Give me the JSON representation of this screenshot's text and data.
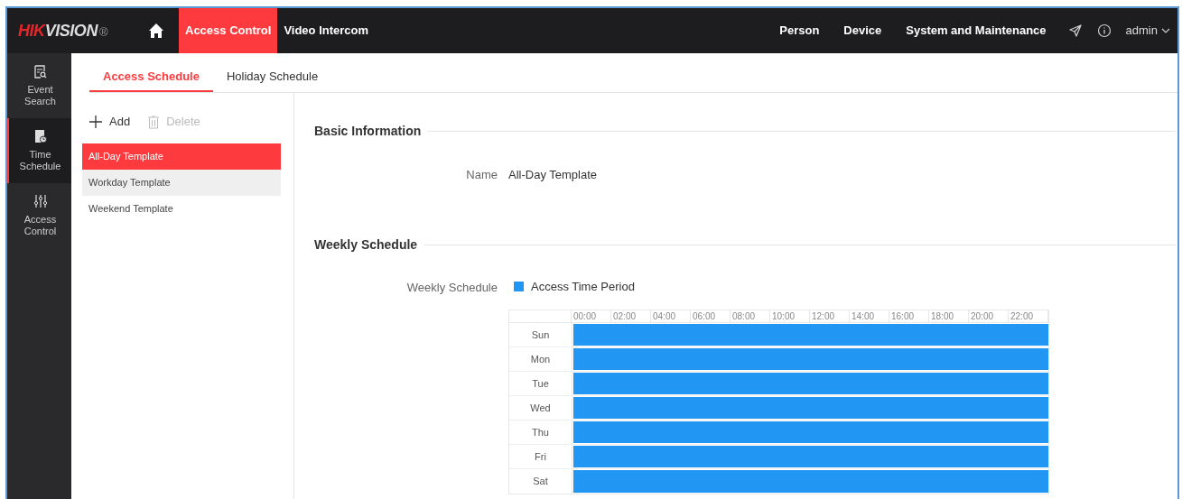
{
  "header": {
    "logo": "HIKVISION",
    "logo_mark": "®",
    "nav": [
      {
        "label": "Access Control",
        "selected": true
      },
      {
        "label": "Video Intercom",
        "selected": false
      }
    ],
    "right_nav": [
      "Person",
      "Device",
      "System and Maintenance"
    ],
    "user": "admin"
  },
  "sidebar": {
    "items": [
      {
        "label": "Event Search",
        "selected": false
      },
      {
        "label": "Time Schedule",
        "selected": true
      },
      {
        "label": "Access Control",
        "selected": false
      }
    ]
  },
  "tabs": [
    {
      "label": "Access Schedule",
      "selected": true
    },
    {
      "label": "Holiday Schedule",
      "selected": false
    }
  ],
  "toolbar": {
    "add": "Add",
    "delete": {
      "label": "Delete",
      "disabled": true
    }
  },
  "templates": [
    {
      "label": "All-Day Template",
      "selected": true,
      "hovered": false
    },
    {
      "label": "Workday Template",
      "selected": false,
      "hovered": true
    },
    {
      "label": "Weekend Template",
      "selected": false,
      "hovered": false
    }
  ],
  "basic_information": {
    "title": "Basic Information",
    "name_label": "Name",
    "name_value": "All-Day Template"
  },
  "weekly_schedule": {
    "title": "Weekly Schedule",
    "label": "Weekly Schedule",
    "legend": {
      "label": "Access Time Period",
      "color": "#2196f3"
    },
    "hours": [
      "00:00",
      "02:00",
      "04:00",
      "06:00",
      "08:00",
      "10:00",
      "12:00",
      "14:00",
      "16:00",
      "18:00",
      "20:00",
      "22:00"
    ],
    "days": [
      {
        "label": "Sun"
      },
      {
        "label": "Mon"
      },
      {
        "label": "Tue"
      },
      {
        "label": "Wed"
      },
      {
        "label": "Thu"
      },
      {
        "label": "Fri"
      },
      {
        "label": "Sat"
      }
    ]
  }
}
